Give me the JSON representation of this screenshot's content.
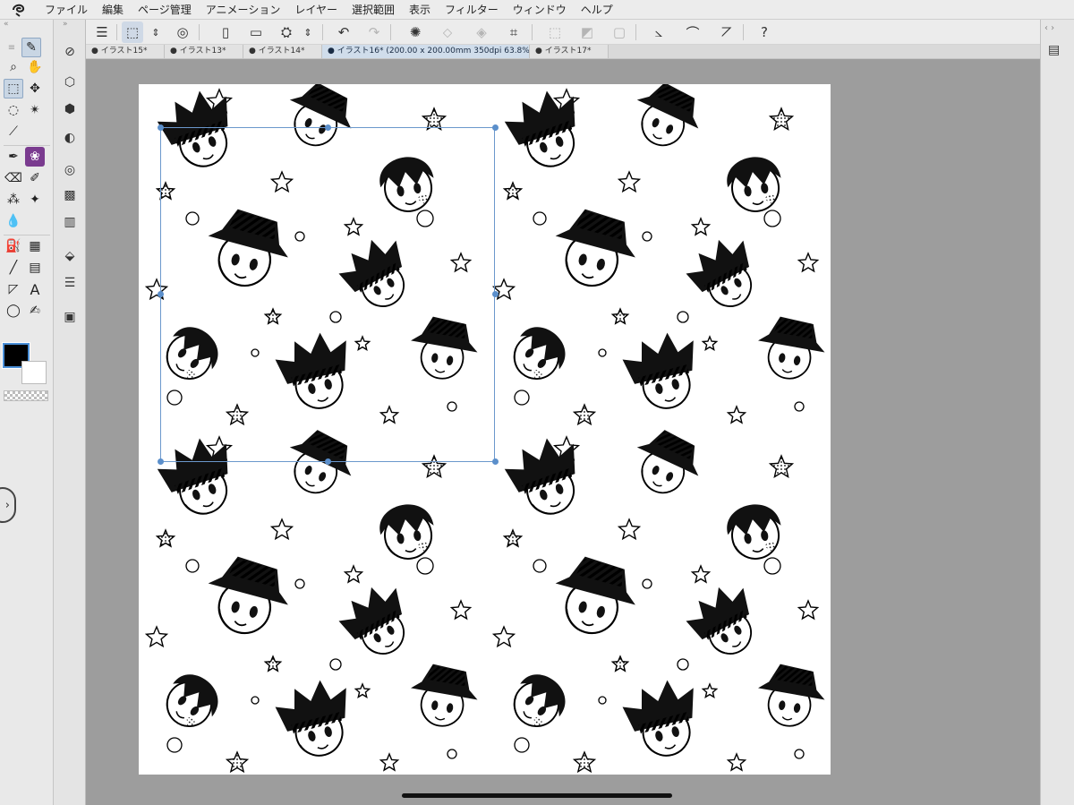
{
  "menu": {
    "items": [
      "ファイル",
      "編集",
      "ページ管理",
      "アニメーション",
      "レイヤー",
      "選択範囲",
      "表示",
      "フィルター",
      "ウィンドウ",
      "ヘルプ"
    ]
  },
  "tabs": [
    {
      "label": "● イラスト15*",
      "active": false
    },
    {
      "label": "● イラスト13*",
      "active": false
    },
    {
      "label": "● イラスト14*",
      "active": false
    },
    {
      "label": "● イラスト16* (200.00 x 200.00mm 350dpi 63.8%)",
      "active": true
    },
    {
      "label": "● イラスト17*",
      "active": false
    }
  ],
  "colors": {
    "main": "#000000",
    "sub": "#ffffff",
    "selection": "#5b8fcb"
  },
  "commands": [
    "menu-icon",
    "transform-icon",
    "new-icon",
    "open-icon",
    "save-icon",
    "undo-icon",
    "redo-icon",
    "rotate-icon",
    "help-icon"
  ],
  "tools": [
    "brush-icon",
    "zoom-icon",
    "hand-icon",
    "move-icon",
    "lasso-icon",
    "magic-wand-icon",
    "eyedropper-icon",
    "pen-icon",
    "eraser-icon",
    "fill-icon",
    "gradient-icon",
    "line-icon",
    "text-icon"
  ]
}
